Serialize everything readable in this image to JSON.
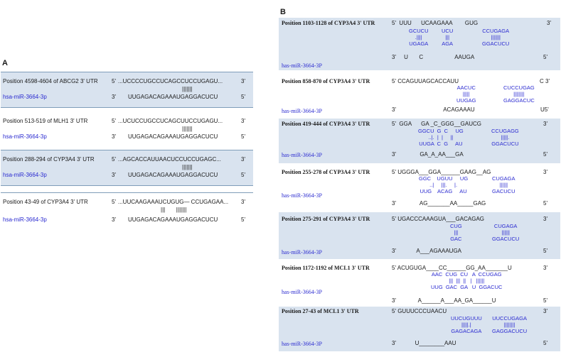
{
  "panelA": {
    "label": "A",
    "rows": [
      {
        "title": "Position 4598-4604 of ABCG2 3' UTR",
        "p5": "5'",
        "target": "...UCCCCUGCCUCAGCCUCCUGAGU...",
        "bars": "|||||||",
        "p3a": "3'",
        "mir": "hsa-miR-3664-3p",
        "p3b": "3'",
        "mirseq": "UUGAGACAGAAAUGAGGACUCU",
        "p5b": "5'"
      },
      {
        "title": "Position 513-519 of MLH1 3' UTR",
        "p5": "5'",
        "target": "...UCUCCUGCCUCAGCUUCCUGAGU...",
        "bars": "|||||||",
        "p3a": "3'",
        "mir": "hsa-miR-3664-3p",
        "p3b": "3'",
        "mirseq": "UUGAGACAGAAAUGAGGACUCU",
        "p5b": "5'"
      },
      {
        "title": "Position 288-294 of CYP3A4 3' UTR",
        "p5": "5'",
        "target": "...AGCACCAUUAACUCCUCCUGAGC...",
        "bars": "|||||||",
        "p3a": "3'",
        "mir": "hsa-miR-3664-3p",
        "p3b": "3'",
        "mirseq": "UUGAGACAGAAAUGAGGACUCU",
        "p5b": "5'"
      },
      {
        "title": "Position 43-49 of CYP3A4 3' UTR",
        "p5": "5'",
        "target": "...UUCAAGAAAUCUGUG— CCUGAGAA...",
        "bars": "|||       |||||||",
        "p3a": "3'",
        "mir": "hsa-miR-3664-3p",
        "p3b": "3'",
        "mirseq": "UUGAGACAGAAAUGAGGACUCU",
        "p5b": "5'"
      }
    ]
  },
  "panelB": {
    "label": "B",
    "rows": [
      {
        "title": "Position 1103-1128 of CYP3A4 3' UTR",
        "mir": "has-miR-3664-3P",
        "top": "5'  UUU      UCAAGAAA        GUG",
        "topEnd": "3'",
        "pairs": [
          [
            "GCUCU",
            ".||||",
            "UGAGA"
          ],
          [
            "UCU",
            "|||",
            "AGA"
          ],
          [
            "CCUGAGA",
            "|||||||",
            "GGACUCU"
          ]
        ],
        "bottom": "3'     U       C                    AAUGA",
        "bottomEnd": "5'"
      },
      {
        "title": "Position 858-870 of CYP3A4 3' UTR",
        "mir": "has-miR-3664-3P",
        "top": "5' CCAGUUAGCACCAUU",
        "topEnd": "C 3'",
        "pairs": [
          [
            "AACUC",
            "|||||",
            "UUGAG"
          ],
          [
            "CUCCUGAG",
            "||||||||",
            "GAGGACUC"
          ]
        ],
        "bottom": "3'                              ACAGAAAU",
        "bottomEnd": "U5'"
      },
      {
        "title": "Position 419-444 of CYP3A4 3' UTR",
        "mir": "has-miR-3664-3P",
        "top": "5'  GGA      GA _C_GGG__GAUCG",
        "topEnd": "3'",
        "pairs": [
          [
            "GGCU  G  C     UG",
            "..|.  |  |     ||",
            "UUGA  C  G     AU"
          ],
          [
            "CCUGAGG",
            "|||||.",
            "GGACUCU"
          ]
        ],
        "bottom": "3'               GA_A_AA___GA",
        "bottomEnd": "5'"
      },
      {
        "title": "Position 255-278 of CYP3A4 3' UTR",
        "mir": "has-miR-3664-3P",
        "top": "5' UGGGA___GGA______GAAG__AG",
        "topEnd": "3'",
        "pairs": [
          [
            "GGC    UGUU     UG",
            "..|     |||.     |.",
            "UUG    ACAG     AU"
          ],
          [
            "CUGAGA",
            "||||||",
            "GACUCU"
          ]
        ],
        "bottom": "3'               AG_______AA_____GAG",
        "bottomEnd": "5'"
      },
      {
        "title": "Position 275-291 of CYP3A4 3' UTR",
        "mir": "has-miR-3664-3P",
        "top": "5' UGACCCAAAGUA___GACAGAG",
        "topEnd": "3'",
        "pairs": [
          [
            "CUG",
            "|||",
            "GAC"
          ],
          [
            "CUGAGA",
            "||||||",
            "GGACUCU"
          ]
        ],
        "bottom": "3'             A___AGAAAUGA",
        "bottomEnd": "5'"
      },
      {
        "title": "Position 1172-1192 of MCL1 3' UTR",
        "mir": "has-miR-3664-3P",
        "top": "5' ACUGUGA____CC______GG_AA_______U",
        "topEnd": "3'",
        "pairs": [
          [
            "AAC  CUG  CU   A  CCUGAG",
            "|||  |||  ||   |   ||||||",
            "UUG  GAC  GA   U  GGACUC"
          ]
        ],
        "bottom": "3'              A______A___AA_GA______U",
        "bottomEnd": "5'"
      },
      {
        "title": "Position 27-43 of MCL1 3' UTR",
        "mir": "has-miR-3664-3P",
        "top": "5' GUUUCCCUAACU",
        "topEnd": "3'",
        "pairs": [
          [
            "UUCUGUUU",
            "|||||.|",
            "GAGACAGA"
          ],
          [
            "UUCCUGAGA",
            "||||||||",
            "GAGGACUCU"
          ]
        ],
        "bottom": "3'            U________AAU",
        "bottomEnd": "5'"
      }
    ]
  }
}
